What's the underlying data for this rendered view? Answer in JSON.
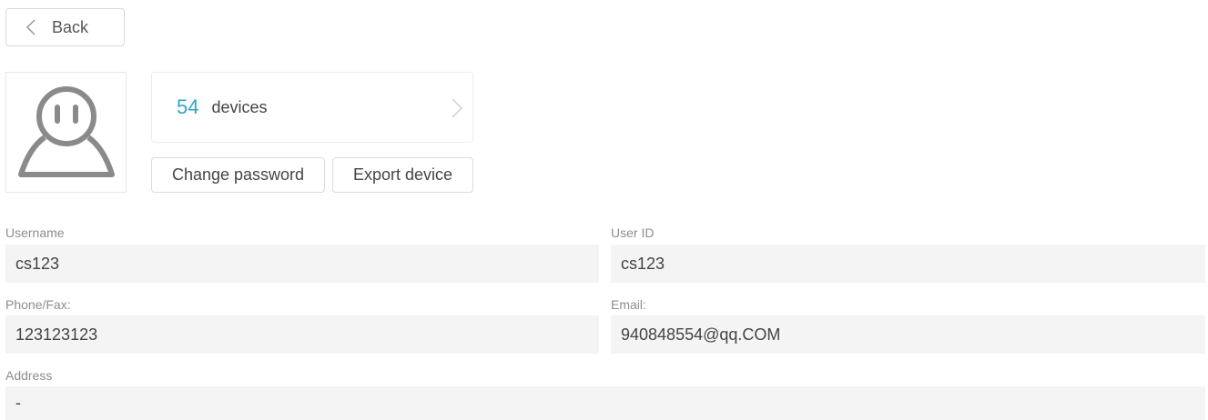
{
  "header": {
    "back_label": "Back"
  },
  "profile": {
    "avatar_icon": "user-avatar-icon",
    "devices_count": "54",
    "devices_label": "devices",
    "change_password_label": "Change password",
    "export_device_label": "Export device"
  },
  "fields": {
    "username": {
      "label": "Username",
      "value": "cs123"
    },
    "user_id": {
      "label": "User ID",
      "value": "cs123"
    },
    "phone": {
      "label": "Phone/Fax:",
      "value": "123123123"
    },
    "email": {
      "label": "Email:",
      "value": "940848554@qq.COM"
    },
    "address": {
      "label": "Address",
      "value": "-"
    }
  },
  "colors": {
    "accent": "#2fa6c4",
    "field_background": "#f4f4f4",
    "label_text": "#8c8c8c"
  }
}
